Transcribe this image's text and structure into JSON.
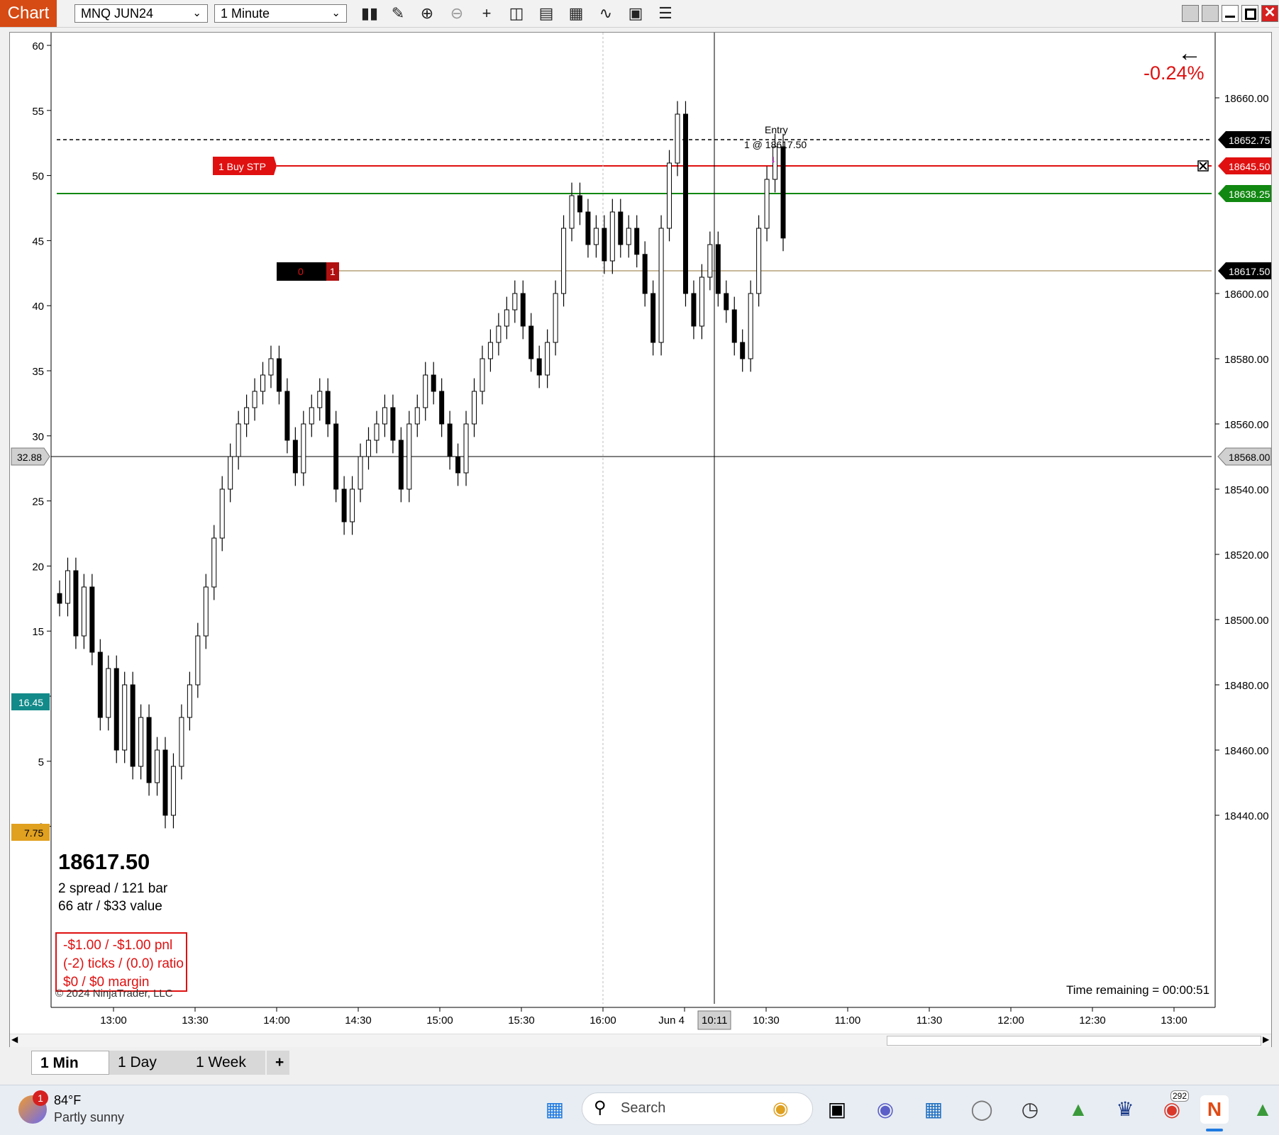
{
  "toolbar": {
    "tab_label": "Chart",
    "instrument": "MNQ JUN24",
    "interval": "1 Minute",
    "tools": [
      "bars-type-icon",
      "drawing-pencil-icon",
      "zoom-in-icon",
      "zoom-out-icon",
      "crosshair-icon",
      "data-box-icon",
      "properties-icon",
      "chart-trader-icon",
      "strategies-icon",
      "indicators-icon",
      "menu-list-icon"
    ]
  },
  "colors": {
    "accent": "#d64a14",
    "buy_stop": "#e01010",
    "target": "#118811",
    "entry": "#c8b89a",
    "cursor_box": "#d0d0d0"
  },
  "chart": {
    "right_labels": [
      "18660.00",
      "18600.00",
      "18580.00",
      "18560.00",
      "18540.00",
      "18520.00",
      "18500.00",
      "18480.00",
      "18460.00",
      "18440.00"
    ],
    "left_labels": [
      "60",
      "55",
      "50",
      "45",
      "40",
      "35",
      "30",
      "25",
      "20",
      "15",
      "10",
      "5",
      "0"
    ],
    "time_labels": [
      "13:00",
      "13:30",
      "14:00",
      "14:30",
      "15:00",
      "15:30",
      "16:00",
      "Jun 4",
      "10:30",
      "11:00",
      "11:30",
      "12:00",
      "12:30",
      "13:00"
    ],
    "cursor_time": "10:11",
    "price_tags": {
      "last_close": "18652.75",
      "buy_stop": "18645.50",
      "target": "18638.25",
      "entry": "18617.50",
      "cursor": "18568.00"
    },
    "left_tags": {
      "cursor": "32.88",
      "teal": "16.45",
      "orange": "7.75"
    },
    "order_label": "1 Buy STP",
    "position_left": "0",
    "position_right": "1",
    "entry_label": "Entry",
    "entry_fill": "1 @ 18617.50",
    "percent_change": "-0.24%",
    "time_remaining": "Time remaining = 00:00:51",
    "copyright": "© 2024 NinjaTrader, LLC"
  },
  "info": {
    "price": "18617.50",
    "line1": "2 spread / 121 bar",
    "line2": "66 atr / $33 value",
    "pnl1": "-$1.00 / -$1.00 pnl",
    "pnl2": "(-2) ticks / (0.0) ratio",
    "pnl3": "$0 / $0 margin"
  },
  "chart_data": {
    "type": "candlestick",
    "title": "",
    "xlabel": "",
    "ylabel": "",
    "ylim": [
      18430,
      18670
    ],
    "series": [
      {
        "values": [
          18505,
          18515,
          18495,
          18510,
          18490,
          18470,
          18485,
          18460,
          18480,
          18455,
          18470,
          18450,
          18460,
          18440,
          18455,
          18470,
          18480,
          18495,
          18510,
          18525,
          18540,
          18550,
          18560,
          18565,
          18570,
          18575,
          18580,
          18570,
          18555,
          18545,
          18560,
          18565,
          18570,
          18560,
          18540,
          18530,
          18540,
          18550,
          18555,
          18560,
          18565,
          18555,
          18540,
          18560,
          18565,
          18575,
          18570,
          18560,
          18550,
          18545,
          18560,
          18570,
          18580,
          18585,
          18590,
          18595,
          18600,
          18590,
          18580,
          18575,
          18585,
          18600,
          18620,
          18630,
          18625,
          18615,
          18620,
          18610,
          18625,
          18615,
          18620,
          18612,
          18600,
          18585,
          18620,
          18640,
          18655,
          18600,
          18590,
          18605,
          18615,
          18600,
          18595,
          18585,
          18580,
          18600,
          18620,
          18635,
          18645,
          18617
        ]
      }
    ],
    "horizontal_lines": [
      {
        "label": "18652.75"
      },
      {
        "label": "18645.50"
      },
      {
        "label": "18638.25"
      },
      {
        "label": "18617.50"
      },
      {
        "label": "18568.00"
      }
    ]
  },
  "bottom_tabs": [
    "1 Min",
    "1 Day",
    "1 Week",
    "+"
  ],
  "taskbar": {
    "weather_temp": "84°F",
    "weather_desc": "Partly sunny",
    "weather_badge": "1",
    "search_placeholder": "Search",
    "chrome_badge": "292"
  }
}
